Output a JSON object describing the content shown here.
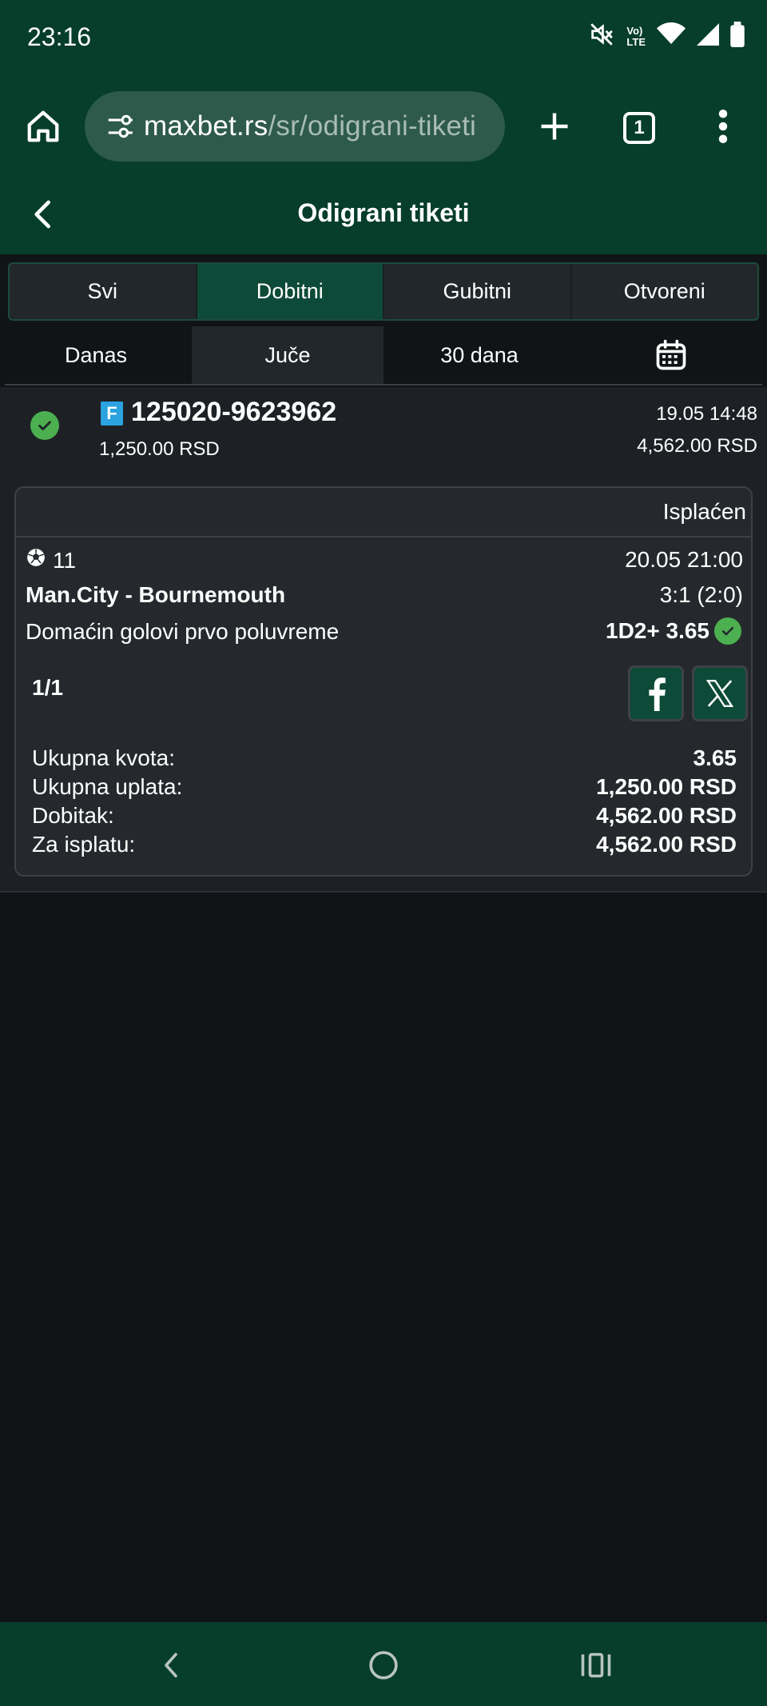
{
  "status_bar": {
    "time": "23:16",
    "volte_top": "Vo)",
    "volte_bottom": "LTE"
  },
  "browser": {
    "url_domain": "maxbet.rs",
    "url_path": "/sr/odigrani-tiketi",
    "tab_count": "1"
  },
  "header": {
    "title": "Odigrani tiketi"
  },
  "filter_tabs": [
    "Svi",
    "Dobitni",
    "Gubitni",
    "Otvoreni"
  ],
  "period_tabs": [
    "Danas",
    "Juče",
    "30 dana"
  ],
  "ticket": {
    "badge": "F",
    "id": "125020-9623962",
    "stake": "1,250.00 RSD",
    "date": "19.05 14:48",
    "payout": "4,562.00 RSD",
    "status": "Isplaćen",
    "match": {
      "code": "11",
      "datetime": "20.05 21:00",
      "name": "Man.City - Bournemouth",
      "score": "3:1 (2:0)",
      "market": "Domaćin golovi prvo poluvreme",
      "pick": "1D2+ 3.65"
    },
    "combo": "1/1",
    "summary": {
      "total_odds_label": "Ukupna kvota:",
      "total_odds_value": "3.65",
      "total_stake_label": "Ukupna uplata:",
      "total_stake_value": "1,250.00 RSD",
      "win_label": "Dobitak:",
      "win_value": "4,562.00 RSD",
      "payout_label": "Za isplatu:",
      "payout_value": "4,562.00 RSD"
    }
  },
  "colors": {
    "brand": "#063d2b",
    "active_tab": "#0d4a37",
    "success": "#4caf50",
    "badge": "#2aa3e0"
  }
}
